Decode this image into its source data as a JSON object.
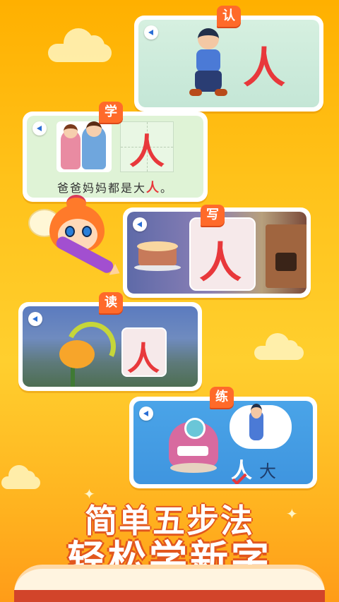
{
  "steps": [
    {
      "tag": "认",
      "big_char": "人"
    },
    {
      "tag": "学",
      "big_char": "人",
      "sentence_prefix": "爸爸妈妈都是大",
      "sentence_highlight": "人",
      "sentence_suffix": "。"
    },
    {
      "tag": "写",
      "big_char": "人"
    },
    {
      "tag": "读",
      "big_char": "人"
    },
    {
      "tag": "练",
      "option_a": "人",
      "option_b": "大"
    }
  ],
  "headline": {
    "line1": "简单五步法",
    "line2": "轻松学新字"
  },
  "colors": {
    "tag": "#ff6a2a",
    "highlight": "#e8383b",
    "background": "#ffc21a"
  }
}
